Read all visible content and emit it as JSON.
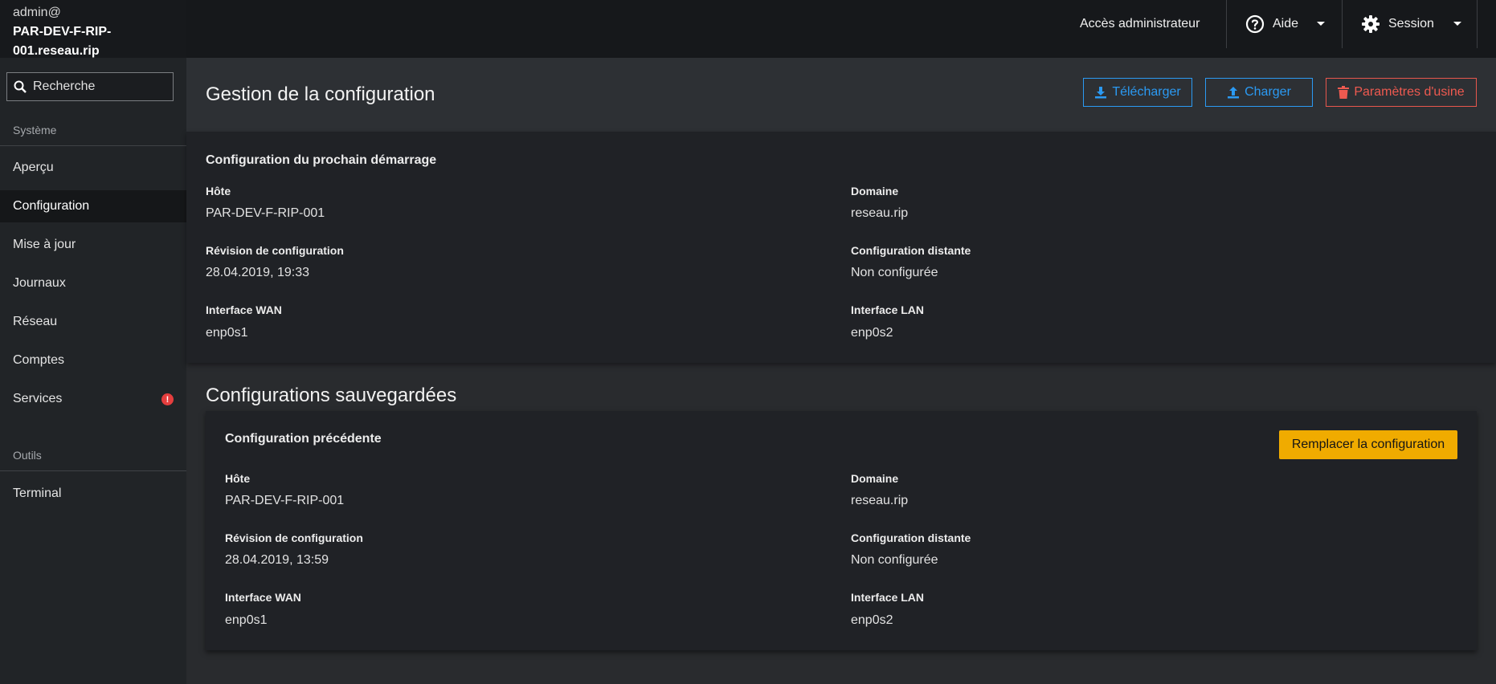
{
  "sidebar": {
    "host_user": "admin@",
    "host_name_line1": "PAR-DEV-F-RIP-",
    "host_name_line2": "001.reseau.rip",
    "search_placeholder": "Recherche",
    "section_system": "Système",
    "items": [
      {
        "label": "Aperçu"
      },
      {
        "label": "Configuration"
      },
      {
        "label": "Mise à jour"
      },
      {
        "label": "Journaux"
      },
      {
        "label": "Réseau"
      },
      {
        "label": "Comptes"
      },
      {
        "label": "Services",
        "badge": "!"
      }
    ],
    "section_tools": "Outils",
    "tools": [
      {
        "label": "Terminal"
      }
    ]
  },
  "topbar": {
    "admin_access": "Accès administrateur",
    "help": "Aide",
    "session": "Session"
  },
  "header": {
    "title": "Gestion de la configuration",
    "download": "Télécharger",
    "upload": "Charger",
    "factory_reset": "Paramètres d'usine"
  },
  "next_boot": {
    "title": "Configuration du prochain démarrage",
    "host_label": "Hôte",
    "host_value": "PAR-DEV-F-RIP-001",
    "domain_label": "Domaine",
    "domain_value": "reseau.rip",
    "revision_label": "Révision de configuration",
    "revision_value": "28.04.2019, 19:33",
    "remote_label": "Configuration distante",
    "remote_value": "Non configurée",
    "wan_label": "Interface WAN",
    "wan_value": "enp0s1",
    "lan_label": "Interface LAN",
    "lan_value": "enp0s2"
  },
  "saved": {
    "section_title": "Configurations sauvegardées",
    "card_title": "Configuration précédente",
    "replace_button": "Remplacer la configuration",
    "host_label": "Hôte",
    "host_value": "PAR-DEV-F-RIP-001",
    "domain_label": "Domaine",
    "domain_value": "reseau.rip",
    "revision_label": "Révision de configuration",
    "revision_value": "28.04.2019, 13:59",
    "remote_label": "Configuration distante",
    "remote_value": "Non configurée",
    "wan_label": "Interface WAN",
    "wan_value": "enp0s1",
    "lan_label": "Interface LAN",
    "lan_value": "enp0s2"
  },
  "colors": {
    "accent_blue": "#2b9af3",
    "danger_red": "#ef5a50",
    "warning_yellow": "#f0ab00"
  }
}
